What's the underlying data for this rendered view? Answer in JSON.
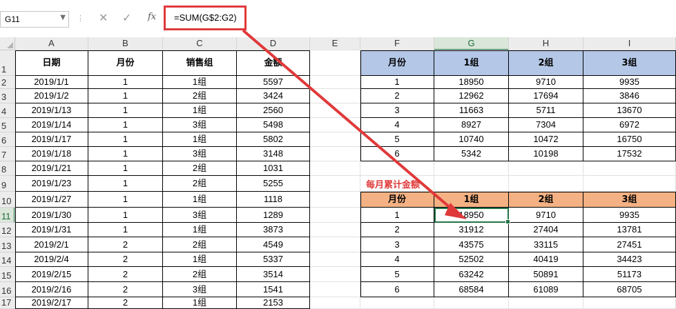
{
  "formula_bar": {
    "name_box": "G11",
    "formula": "=SUM(G$2:G2)",
    "dropdown_icon": "chevron-down-icon",
    "cancel_icon": "x-icon",
    "enter_icon": "check-icon",
    "fx_icon": "fx-icon"
  },
  "columns": [
    "A",
    "B",
    "C",
    "D",
    "E",
    "F",
    "G",
    "H",
    "I"
  ],
  "rows": [
    "1",
    "2",
    "3",
    "4",
    "5",
    "6",
    "7",
    "8",
    "9",
    "10",
    "11",
    "12",
    "13",
    "14",
    "15",
    "16",
    "17"
  ],
  "left_table": {
    "headers": [
      "日期",
      "月份",
      "销售组",
      "金额"
    ],
    "rows": [
      [
        "2019/1/1",
        "1",
        "1组",
        "5597"
      ],
      [
        "2019/1/2",
        "1",
        "2组",
        "3424"
      ],
      [
        "2019/1/13",
        "1",
        "1组",
        "2560"
      ],
      [
        "2019/1/14",
        "1",
        "3组",
        "5498"
      ],
      [
        "2019/1/17",
        "1",
        "1组",
        "5802"
      ],
      [
        "2019/1/18",
        "1",
        "3组",
        "3148"
      ],
      [
        "2019/1/21",
        "1",
        "2组",
        "1031"
      ],
      [
        "2019/1/23",
        "1",
        "2组",
        "5255"
      ],
      [
        "2019/1/27",
        "1",
        "1组",
        "1118"
      ],
      [
        "2019/1/30",
        "1",
        "3组",
        "1289"
      ],
      [
        "2019/1/31",
        "1",
        "1组",
        "3873"
      ],
      [
        "2019/2/1",
        "2",
        "2组",
        "4549"
      ],
      [
        "2019/2/4",
        "2",
        "1组",
        "5337"
      ],
      [
        "2019/2/15",
        "2",
        "2组",
        "3514"
      ],
      [
        "2019/2/16",
        "2",
        "3组",
        "1541"
      ],
      [
        "2019/2/17",
        "2",
        "1组",
        "2153"
      ]
    ]
  },
  "top_right_table": {
    "headers": [
      "月份",
      "1组",
      "2组",
      "3组"
    ],
    "rows": [
      [
        "1",
        "18950",
        "9710",
        "9935"
      ],
      [
        "2",
        "12962",
        "17694",
        "3846"
      ],
      [
        "3",
        "11663",
        "5711",
        "13670"
      ],
      [
        "4",
        "8927",
        "7304",
        "6972"
      ],
      [
        "5",
        "10740",
        "10472",
        "16750"
      ],
      [
        "6",
        "5342",
        "10198",
        "17532"
      ]
    ]
  },
  "cumulative_label": "每月累计金额",
  "bottom_right_table": {
    "headers": [
      "月份",
      "1组",
      "2组",
      "3组"
    ],
    "rows": [
      [
        "1",
        "18950",
        "9710",
        "9935"
      ],
      [
        "2",
        "31912",
        "27404",
        "13781"
      ],
      [
        "3",
        "43575",
        "33115",
        "27451"
      ],
      [
        "4",
        "52502",
        "40419",
        "34423"
      ],
      [
        "5",
        "63242",
        "50891",
        "51173"
      ],
      [
        "6",
        "68584",
        "61089",
        "68705"
      ]
    ]
  },
  "colors": {
    "accent_green": "#217346",
    "highlight_red": "#e0393a",
    "header_blue": "#b4c7e7",
    "header_orange": "#f4b183"
  }
}
